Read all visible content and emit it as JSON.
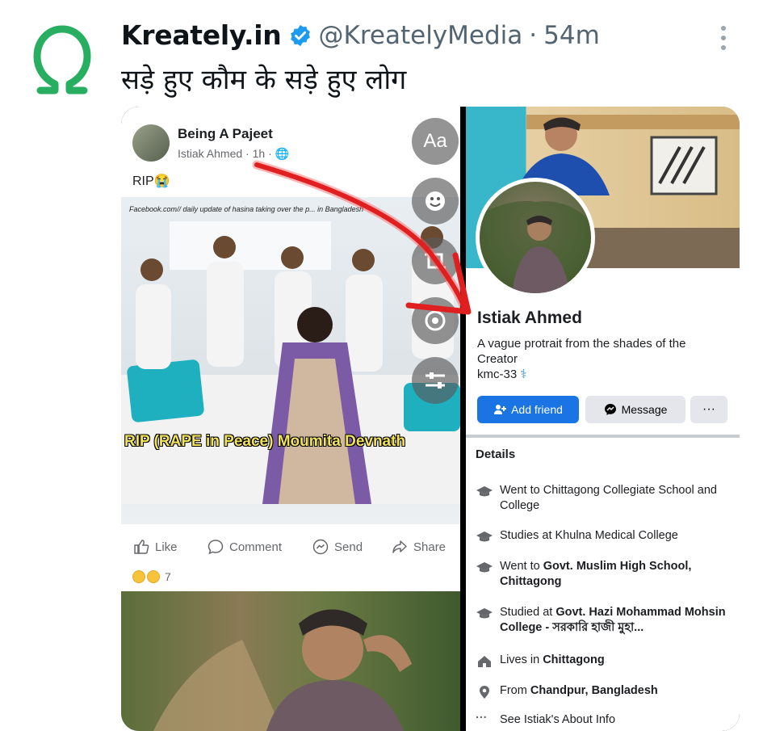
{
  "tweet": {
    "author_name": "Kreately.in",
    "handle": "@KreatelyMedia",
    "separator": "·",
    "time": "54m",
    "text": "सड़े हुए कौम के सड़े हुए लोग"
  },
  "left_post": {
    "page_name": "Being A Pajeet",
    "author": "Istiak Ahmed",
    "age": "1h",
    "caption": "RIP😭",
    "image_watermark": "Facebook.com// daily update of hasina taking over the p... in Bangladesh",
    "image_caption": "RIP (RAPE in Peace) Moumita Devnath",
    "tools": {
      "text_tool": "Aa"
    },
    "actions": [
      "Like",
      "Comment",
      "Send",
      "Share"
    ],
    "reaction_count": "7"
  },
  "profile": {
    "name": "Istiak Ahmed",
    "bio": "A vague protrait from the shades of the Creator",
    "tag": "kmc-33",
    "add_friend": "Add friend",
    "message": "Message",
    "more": "···",
    "details_title": "Details",
    "details": [
      {
        "prefix": "Went to Chittagong Collegiate School and College",
        "bold": ""
      },
      {
        "prefix": "Studies at Khulna Medical College",
        "bold": ""
      },
      {
        "prefix": "Went to ",
        "bold": "Govt. Muslim High School, Chittagong"
      },
      {
        "prefix": "Studied at ",
        "bold": "Govt. Hazi Mohammad Mohsin College - সরকারি হাজী মুহা..."
      },
      {
        "prefix": "Lives in ",
        "bold": "Chittagong"
      },
      {
        "prefix": "From ",
        "bold": "Chandpur, Bangladesh"
      },
      {
        "prefix": "See Istiak's About Info",
        "bold": ""
      }
    ]
  },
  "colors": {
    "logo_green": "#27ae60",
    "verified_blue": "#1d9bf0",
    "fb_blue": "#1b74e4",
    "arrow_red": "#e02020"
  }
}
